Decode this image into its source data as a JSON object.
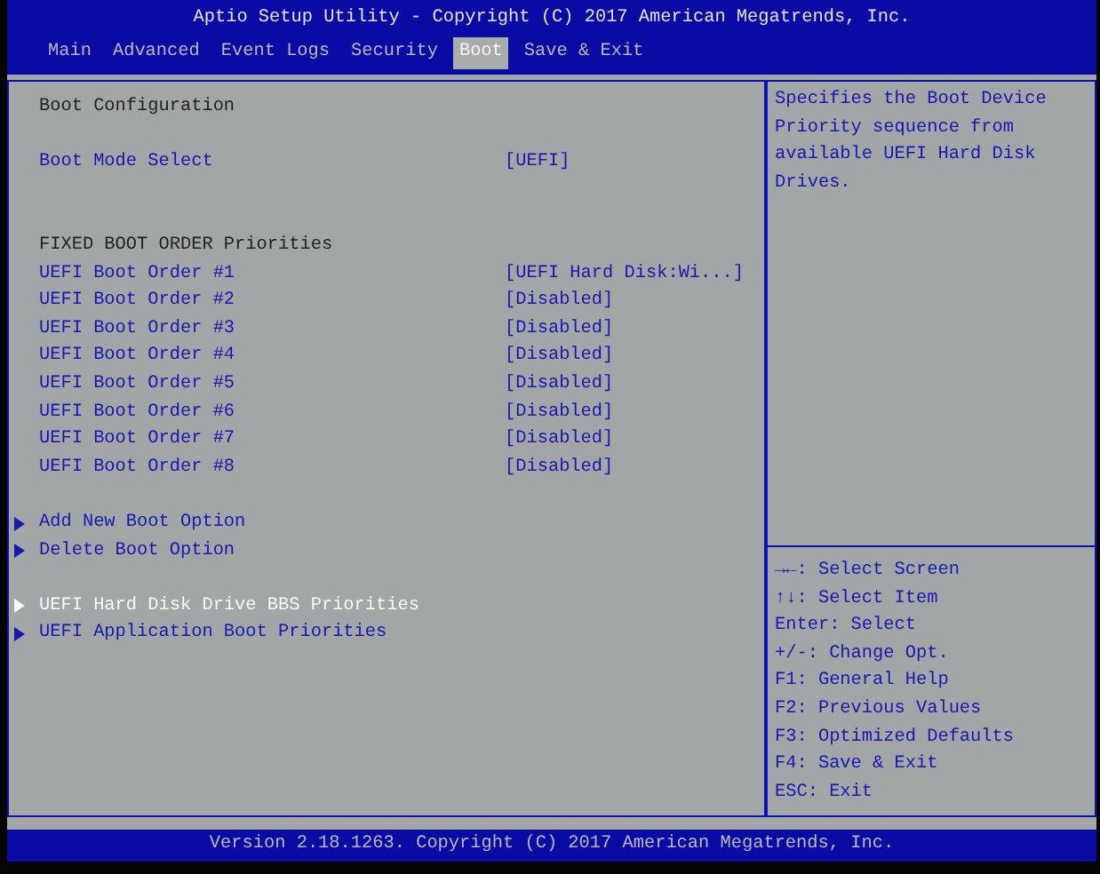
{
  "window": {
    "title": "Aptio Setup Utility - Copyright (C) 2017 American Megatrends, Inc."
  },
  "tabs": [
    {
      "label": "Main",
      "selected": false
    },
    {
      "label": "Advanced",
      "selected": false
    },
    {
      "label": "Event Logs",
      "selected": false
    },
    {
      "label": "Security",
      "selected": false
    },
    {
      "label": "Boot",
      "selected": true
    },
    {
      "label": "Save & Exit",
      "selected": false
    }
  ],
  "menu": [
    {
      "kind": "heading",
      "label": "Boot Configuration"
    },
    {
      "kind": "gap"
    },
    {
      "kind": "setting",
      "label": "Boot Mode Select",
      "value": "[UEFI]",
      "selected": false
    },
    {
      "kind": "gap"
    },
    {
      "kind": "gap"
    },
    {
      "kind": "heading",
      "label": "FIXED BOOT ORDER Priorities"
    },
    {
      "kind": "setting",
      "label": "UEFI Boot Order #1",
      "value": "[UEFI Hard Disk:Wi...]",
      "selected": false
    },
    {
      "kind": "setting",
      "label": "UEFI Boot Order #2",
      "value": "[Disabled]",
      "selected": false
    },
    {
      "kind": "setting",
      "label": "UEFI Boot Order #3",
      "value": "[Disabled]",
      "selected": false
    },
    {
      "kind": "setting",
      "label": "UEFI Boot Order #4",
      "value": "[Disabled]",
      "selected": false
    },
    {
      "kind": "setting",
      "label": "UEFI Boot Order #5",
      "value": "[Disabled]",
      "selected": false
    },
    {
      "kind": "setting",
      "label": "UEFI Boot Order #6",
      "value": "[Disabled]",
      "selected": false
    },
    {
      "kind": "setting",
      "label": "UEFI Boot Order #7",
      "value": "[Disabled]",
      "selected": false
    },
    {
      "kind": "setting",
      "label": "UEFI Boot Order #8",
      "value": "[Disabled]",
      "selected": false
    },
    {
      "kind": "gap"
    },
    {
      "kind": "submenu",
      "label": "Add New Boot Option",
      "selected": false
    },
    {
      "kind": "submenu",
      "label": "Delete Boot Option",
      "selected": false
    },
    {
      "kind": "gap"
    },
    {
      "kind": "submenu",
      "label": "UEFI Hard Disk Drive BBS Priorities",
      "selected": true
    },
    {
      "kind": "submenu",
      "label": "UEFI Application Boot Priorities",
      "selected": false
    }
  ],
  "help": {
    "text": "Specifies the Boot Device Priority sequence from available UEFI Hard Disk Drives."
  },
  "keys": [
    "→←: Select Screen",
    "↑↓: Select Item",
    "Enter: Select",
    "+/-: Change Opt.",
    "F1: General Help",
    "F2: Previous Values",
    "F3: Optimized Defaults",
    "F4: Save & Exit",
    "ESC: Exit"
  ],
  "status_bar": {
    "text": "Version 2.18.1263. Copyright (C) 2017 American Megatrends, Inc."
  }
}
